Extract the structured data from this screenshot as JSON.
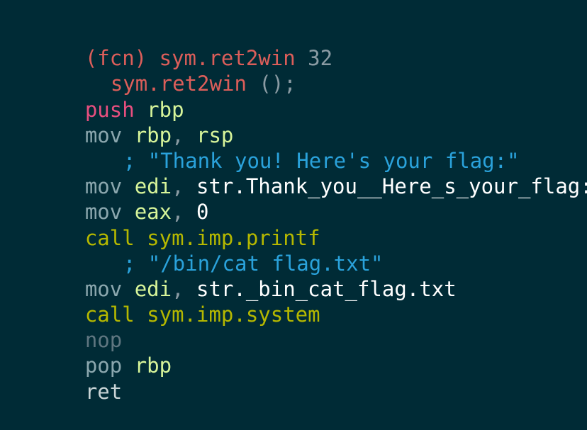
{
  "colors": {
    "background": "#002b36",
    "function_header": "#dc5e5a",
    "number": "#8a9ba3",
    "punctuation": "#8a9ba3",
    "push_mnemonic": "#e84f7f",
    "mov_mnemonic": "#8ba7ae",
    "call_mnemonic": "#b5b800",
    "nop_mnemonic": "#5f7680",
    "pop_mnemonic": "#8ba7ae",
    "ret_mnemonic": "#c9d4d6",
    "register": "#d7f59a",
    "operand": "#ffffff",
    "comment": "#2aa2db",
    "call_target": "#b5b800"
  },
  "disasm": {
    "header": {
      "prefix": "(fcn) ",
      "name": "sym.ret2win",
      "size": " 32"
    },
    "signature": {
      "name": "sym.ret2win",
      "args": " ();"
    },
    "lines": [
      {
        "mnemonic": "push",
        "ops": [
          " rbp"
        ]
      },
      {
        "mnemonic": "mov",
        "ops": [
          " rbp",
          ", ",
          "rsp"
        ]
      },
      {
        "comment": "; \"Thank you! Here's your flag:\""
      },
      {
        "mnemonic": "mov",
        "ops": [
          " edi",
          ", ",
          "str.Thank_you__Here_s_your_flag:"
        ]
      },
      {
        "mnemonic": "mov",
        "ops": [
          " eax",
          ", ",
          "0"
        ]
      },
      {
        "mnemonic": "call",
        "ops": [
          " sym.imp.printf"
        ]
      },
      {
        "comment": "; \"/bin/cat flag.txt\""
      },
      {
        "mnemonic": "mov",
        "ops": [
          " edi",
          ", ",
          "str._bin_cat_flag.txt"
        ]
      },
      {
        "mnemonic": "call",
        "ops": [
          " sym.imp.system"
        ]
      },
      {
        "mnemonic": "nop"
      },
      {
        "mnemonic": "pop",
        "ops": [
          " rbp"
        ]
      },
      {
        "mnemonic": "ret"
      }
    ]
  }
}
